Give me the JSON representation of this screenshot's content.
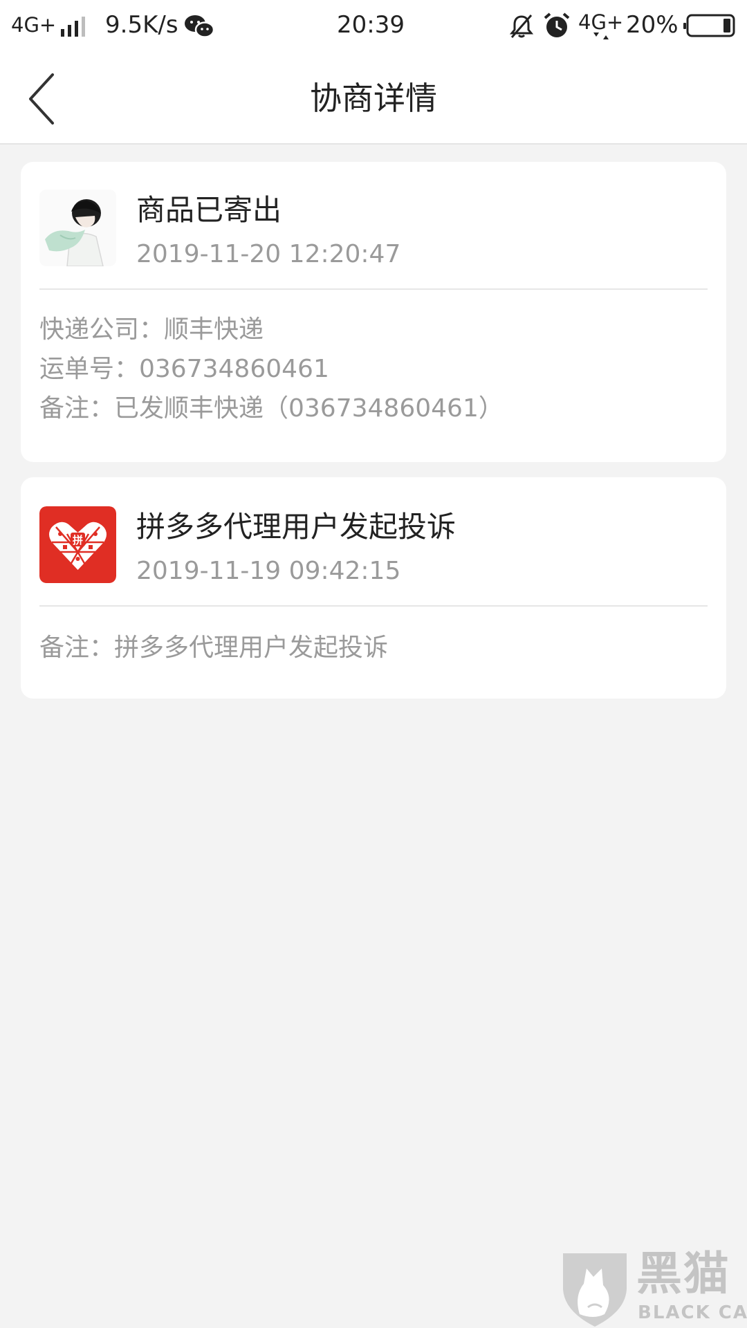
{
  "status_bar": {
    "network_left": "4G+",
    "speed": "9.5K/s",
    "time": "20:39",
    "network_right": "4G+",
    "battery": "20%",
    "icons": [
      "signal-bars-icon",
      "wechat-icon",
      "mute-bell-icon",
      "alarm-icon",
      "battery-icon"
    ]
  },
  "header": {
    "back_icon": "chevron-left-icon",
    "title": "协商详情"
  },
  "records": [
    {
      "avatar": "user-avatar-illustration",
      "title": "商品已寄出",
      "time": "2019-11-20 12:20:47",
      "details": [
        "快递公司：顺丰快递",
        "运单号：036734860461",
        "备注：已发顺丰快递（036734860461）"
      ]
    },
    {
      "avatar": "pinduoduo-logo",
      "logo_text": "拼",
      "title": "拼多多代理用户发起投诉",
      "time": "2019-11-19 09:42:15",
      "details": [
        "备注：拼多多代理用户发起投诉"
      ]
    }
  ],
  "watermark": {
    "main": "黑猫",
    "sub": "BLACK CAT"
  },
  "colors": {
    "background": "#f3f3f3",
    "card": "#ffffff",
    "secondary_text": "#9a9a9a",
    "brand_red": "#e02e24",
    "watermark": "#c4c4c4"
  }
}
